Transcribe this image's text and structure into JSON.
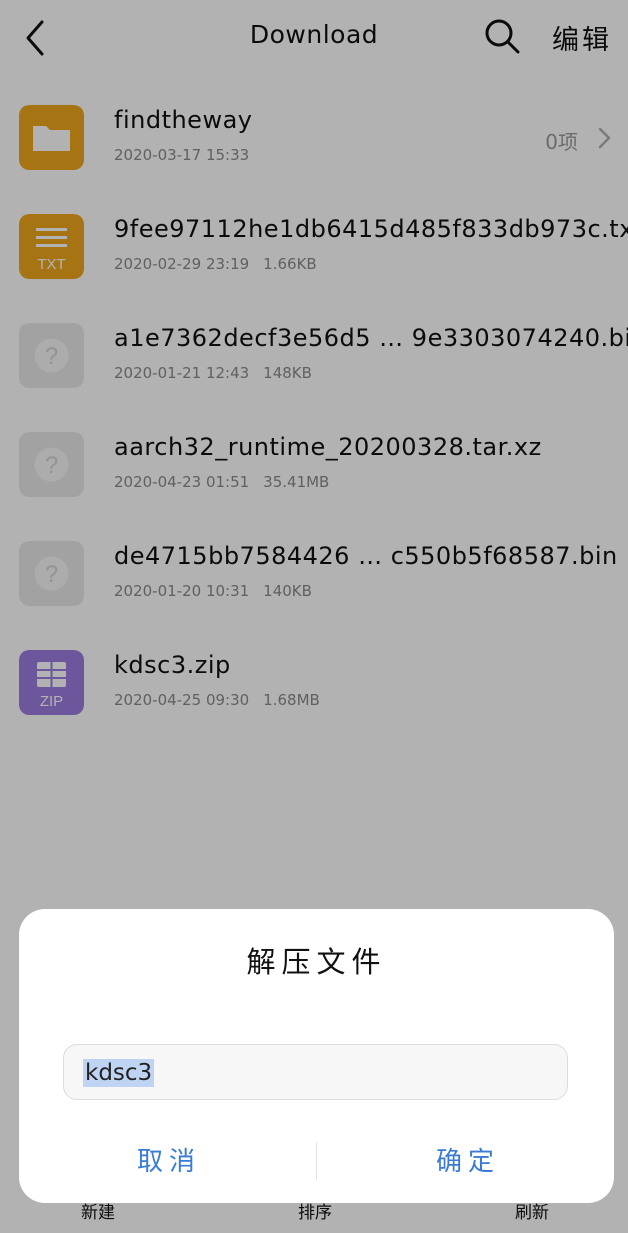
{
  "header": {
    "title": "Download",
    "edit_label": "编辑"
  },
  "files": [
    {
      "name": "findtheway",
      "date": "2020-03-17 15:33",
      "size": "",
      "count": "0项",
      "type": "folder",
      "icon_color": "#f0a71c"
    },
    {
      "name": "9fee97112he1db6415d485f833db973c.txt",
      "date": "2020-02-29 23:19",
      "size": "1.66KB",
      "count": "",
      "type": "txt",
      "icon_label": "TXT",
      "icon_color": "#f0a71c"
    },
    {
      "name": "a1e7362decf3e56d5 … 9e3303074240.bin",
      "date": "2020-01-21 12:43",
      "size": "148KB",
      "count": "",
      "type": "unknown",
      "icon_color": "#e8e8e8"
    },
    {
      "name": "aarch32_runtime_20200328.tar.xz",
      "date": "2020-04-23 01:51",
      "size": "35.41MB",
      "count": "",
      "type": "unknown",
      "icon_color": "#e8e8e8"
    },
    {
      "name": "de4715bb7584426 … c550b5f68587.bin",
      "date": "2020-01-20 10:31",
      "size": "140KB",
      "count": "",
      "type": "unknown",
      "icon_color": "#e8e8e8"
    },
    {
      "name": "kdsc3.zip",
      "date": "2020-04-25 09:30",
      "size": "1.68MB",
      "count": "",
      "type": "zip",
      "icon_label": "ZIP",
      "icon_color": "#9b7be0"
    }
  ],
  "bottom_bar": {
    "new_label": "新建",
    "sort_label": "排序",
    "refresh_label": "刷新"
  },
  "dialog": {
    "title": "解压文件",
    "input_value": "kdsc3",
    "cancel_label": "取消",
    "ok_label": "确定",
    "accent_color": "#3a7bd5"
  }
}
